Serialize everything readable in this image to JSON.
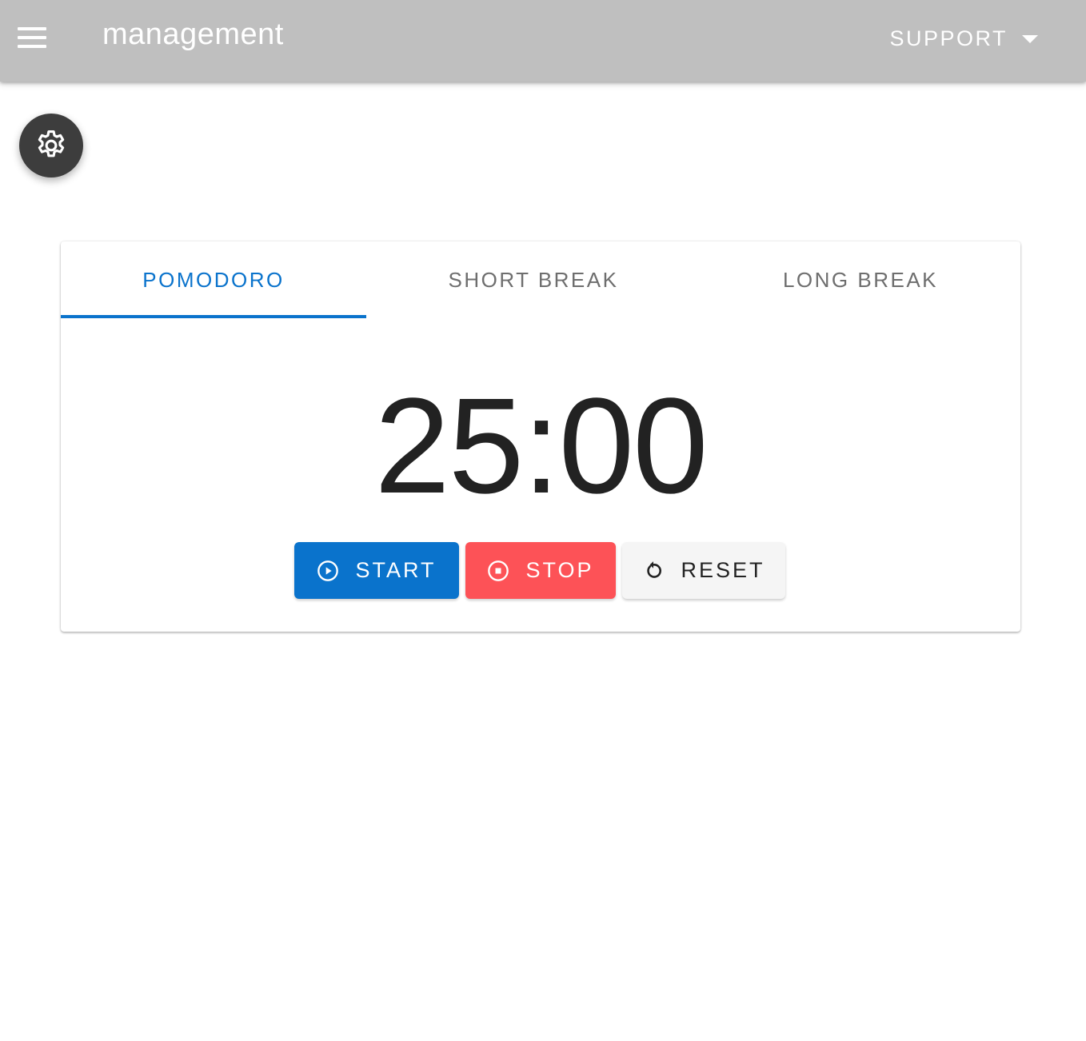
{
  "appbar": {
    "title": "management",
    "support_label": "SUPPORT",
    "menu_icon": "hamburger-menu-icon",
    "caret_icon": "caret-down-icon"
  },
  "fab": {
    "icon": "gear-icon"
  },
  "tabs": [
    {
      "label": "POMODORO",
      "active": true
    },
    {
      "label": "SHORT BREAK",
      "active": false
    },
    {
      "label": "LONG BREAK",
      "active": false
    }
  ],
  "timer": {
    "display": "25:00"
  },
  "controls": {
    "start_label": "START",
    "start_icon": "play-circle-icon",
    "stop_label": "STOP",
    "stop_icon": "stop-circle-icon",
    "reset_label": "RESET",
    "reset_icon": "refresh-icon"
  },
  "colors": {
    "appbar": "#bfbfbf",
    "accent": "#0a73cc",
    "stop": "#fd5257",
    "reset_bg": "#f5f5f5",
    "fab": "#3d3d3d"
  }
}
